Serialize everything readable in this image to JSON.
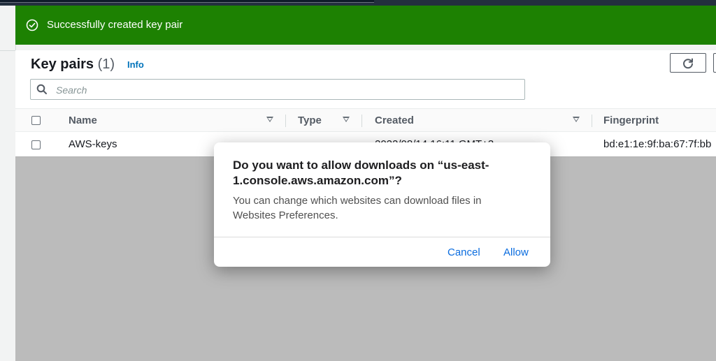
{
  "flash": {
    "message": "Successfully created key pair"
  },
  "header": {
    "title": "Key pairs",
    "count": "(1)",
    "info_label": "Info"
  },
  "search": {
    "placeholder": "Search"
  },
  "table": {
    "columns": [
      "Name",
      "Type",
      "Created",
      "Fingerprint"
    ],
    "rows": [
      {
        "name": "AWS-keys",
        "type": "",
        "created": "2022/08/14 16:11 GMT+3",
        "fingerprint": "bd:e1:1e:9f:ba:67:7f:bb"
      }
    ]
  },
  "dialog": {
    "title": "Do you want to allow downloads on “us-east-1.console.aws.amazon.com”?",
    "body": "You can change which websites can download files in Websites Preferences.",
    "cancel_label": "Cancel",
    "allow_label": "Allow"
  },
  "colors": {
    "flash_bg": "#1d8102",
    "link": "#0073bb",
    "dialog_button": "#0a6cdf",
    "topbar": "#232f3e"
  },
  "icons": {
    "flash": "check-circle-icon",
    "refresh": "refresh-icon",
    "search": "search-icon",
    "sort": "sort-caret-icon"
  }
}
